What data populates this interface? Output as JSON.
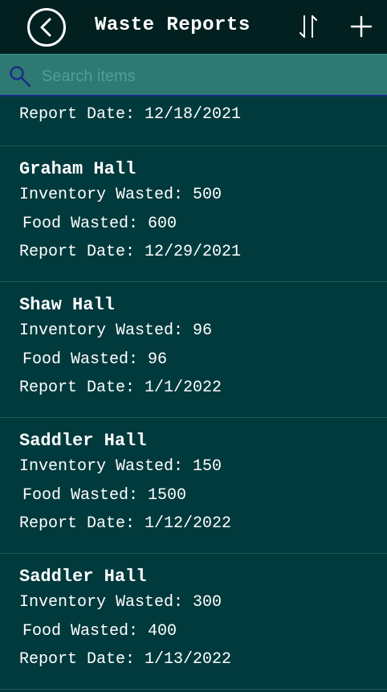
{
  "header": {
    "title": "Waste Reports"
  },
  "search": {
    "placeholder": "Search items"
  },
  "partial_item": {
    "date": "Report Date: 12/18/2021"
  },
  "items": [
    {
      "hall": "Graham Hall",
      "inventory": "Inventory Wasted: 500",
      "food": "Food Wasted: 600",
      "date": "Report Date: 12/29/2021"
    },
    {
      "hall": "Shaw Hall",
      "inventory": "Inventory Wasted: 96",
      "food": "Food Wasted: 96",
      "date": "Report Date: 1/1/2022"
    },
    {
      "hall": "Saddler Hall",
      "inventory": "Inventory Wasted: 150",
      "food": "Food Wasted: 1500",
      "date": "Report Date: 1/12/2022"
    },
    {
      "hall": "Saddler Hall",
      "inventory": "Inventory Wasted: 300",
      "food": "Food Wasted: 400",
      "date": "Report Date: 1/13/2022"
    }
  ],
  "colors": {
    "background": "#013a3d",
    "header": "#02201f",
    "search_bar": "#2e7a72"
  },
  "icons": [
    "back-icon",
    "sort-icon",
    "add-icon",
    "search-icon"
  ]
}
